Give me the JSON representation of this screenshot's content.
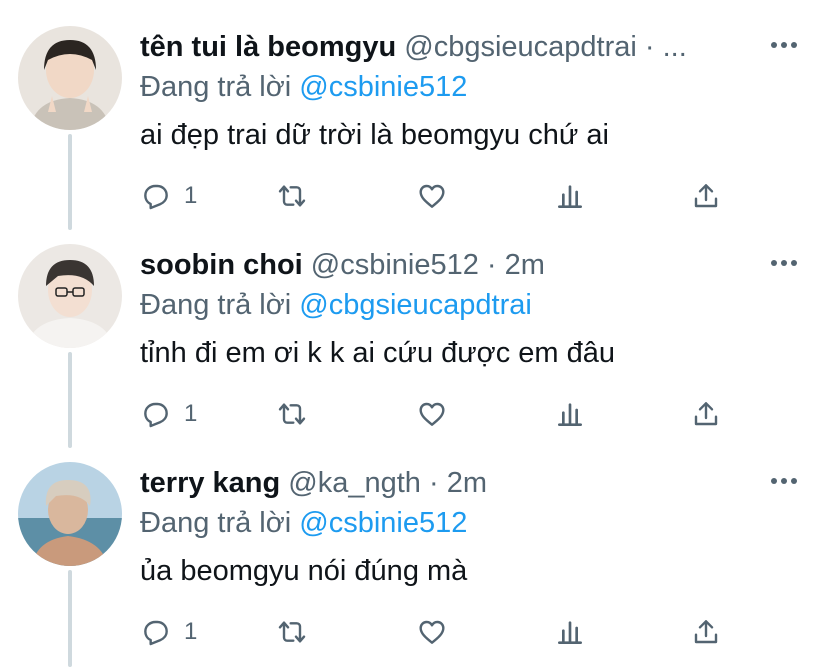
{
  "colors": {
    "text": "#0f1419",
    "secondary": "#536471",
    "link": "#1d9bf0",
    "thread_line": "#cfd9de"
  },
  "reply_prefix": "Đang trả lời",
  "tweets": [
    {
      "name": "tên tui là beomgyu",
      "handle": "@cbgsieucapdtrai · ...",
      "reply_to": "@csbinie512",
      "text": "ai đẹp trai dữ trời là beomgyu chứ ai",
      "reply_count": "1",
      "avatar_icon": "avatar-photo"
    },
    {
      "name": "soobin choi",
      "handle": "@csbinie512 · 2m",
      "reply_to": "@cbgsieucapdtrai",
      "text": "tỉnh đi em ơi k k ai cứu được em đâu",
      "reply_count": "1",
      "avatar_icon": "avatar-photo"
    },
    {
      "name": "terry kang",
      "handle": "@ka_ngth · 2m",
      "reply_to": "@csbinie512",
      "text": "ủa beomgyu nói đúng mà",
      "reply_count": "1",
      "avatar_icon": "avatar-photo"
    }
  ]
}
